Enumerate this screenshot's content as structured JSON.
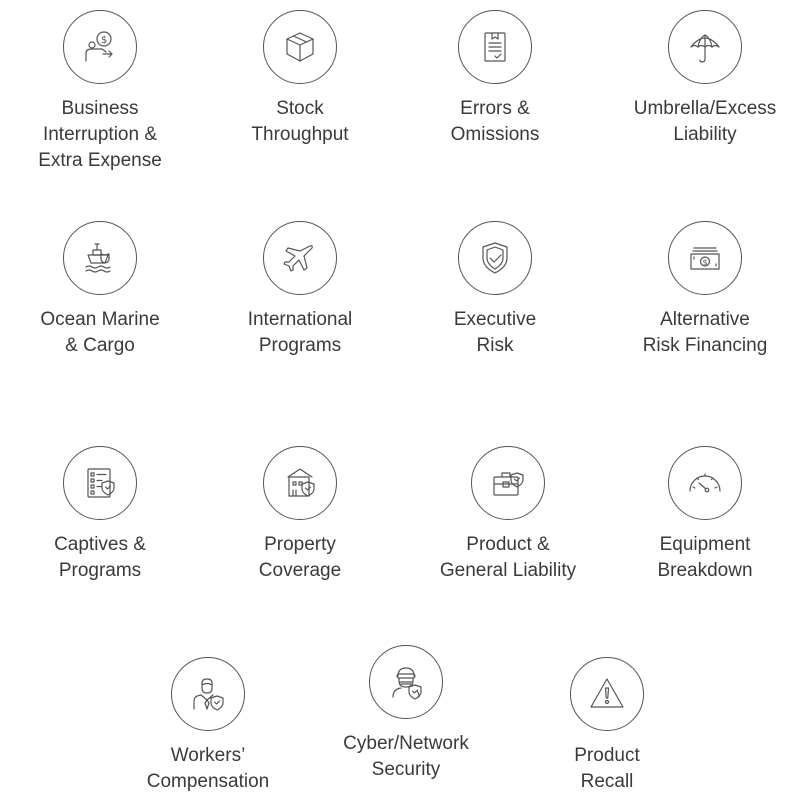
{
  "items": [
    {
      "icon": "money-speech-person-icon",
      "lines": [
        "Business",
        "Interruption &",
        "Extra Expense"
      ]
    },
    {
      "icon": "box-icon",
      "lines": [
        "Stock",
        "Throughput"
      ]
    },
    {
      "icon": "document-check-icon",
      "lines": [
        "Errors &",
        "Omissions"
      ]
    },
    {
      "icon": "umbrella-icon",
      "lines": [
        "Umbrella/Excess",
        "Liability"
      ]
    },
    {
      "icon": "ship-shield-icon",
      "lines": [
        "Ocean Marine",
        "& Cargo"
      ]
    },
    {
      "icon": "airplane-icon",
      "lines": [
        "International",
        "Programs"
      ]
    },
    {
      "icon": "shield-check-icon",
      "lines": [
        "Executive",
        "Risk"
      ]
    },
    {
      "icon": "money-bills-icon",
      "lines": [
        "Alternative",
        "Risk Financing"
      ]
    },
    {
      "icon": "checklist-shield-icon",
      "lines": [
        "Captives &",
        "Programs"
      ]
    },
    {
      "icon": "building-shield-icon",
      "lines": [
        "Property",
        "Coverage"
      ]
    },
    {
      "icon": "briefcase-shield-icon",
      "lines": [
        "Product &",
        "General Liability"
      ]
    },
    {
      "icon": "gauge-icon",
      "lines": [
        "Equipment",
        "Breakdown"
      ]
    },
    {
      "icon": "worker-shield-icon",
      "lines": [
        "Workers’",
        "Compensation"
      ]
    },
    {
      "icon": "hacker-shield-icon",
      "lines": [
        "Cyber/Network",
        "Security"
      ]
    },
    {
      "icon": "warning-icon",
      "lines": [
        "Product",
        "Recall"
      ]
    }
  ]
}
